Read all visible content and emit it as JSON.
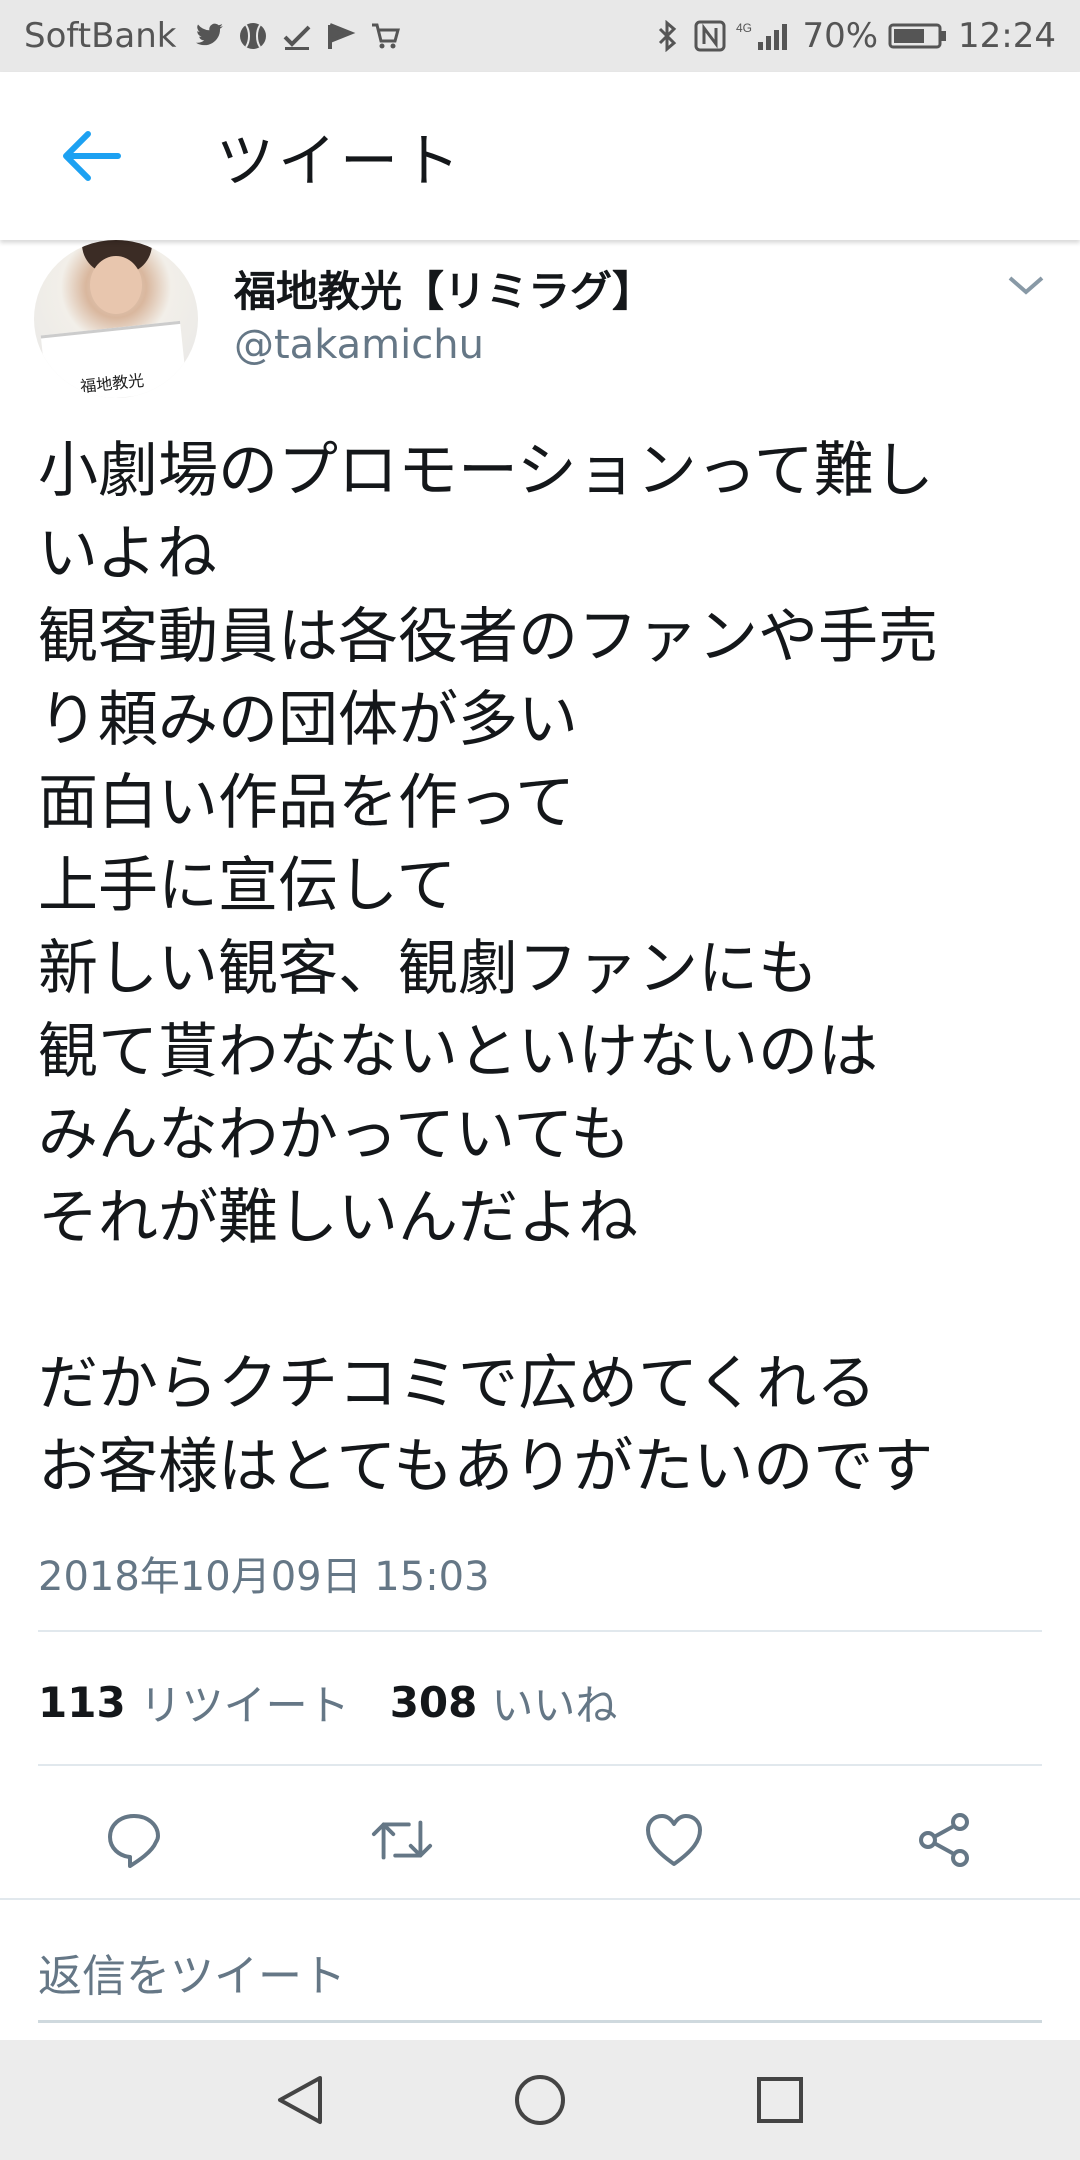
{
  "status_bar": {
    "carrier": "SoftBank",
    "battery": "70%",
    "time": "12:24",
    "network": "4G",
    "icons": [
      "twitter-icon",
      "baseball-icon",
      "check-icon",
      "flag-icon",
      "cart-icon",
      "bluetooth-icon",
      "nfc-icon",
      "signal-icon",
      "battery-icon"
    ]
  },
  "app_bar": {
    "title": "ツイート",
    "back_icon": "back-arrow-icon"
  },
  "tweet": {
    "avatar_caption": "福地教光",
    "username": "福地教光【リミラグ】",
    "handle": "@takamichu",
    "lines": [
      "小劇場のプロモーションって難し",
      "いよね",
      "観客動員は各役者のファンや手売",
      "り頼みの団体が多い",
      "面白い作品を作って",
      "上手に宣伝して",
      "新しい観客、観劇ファンにも",
      "観て貰わなないといけないのは",
      "みんなわかっていても",
      "それが難しいんだよね",
      "",
      "だからクチコミで広めてくれる",
      "お客様はとてもありがたいのです"
    ],
    "timestamp": "2018年10月09日 15:03",
    "retweet_count": "113",
    "retweet_label": "リツイート",
    "like_count": "308",
    "like_label": "いいね"
  },
  "actions": [
    "reply-icon",
    "retweet-icon",
    "like-icon",
    "share-icon"
  ],
  "reply": {
    "placeholder": "返信をツイート"
  },
  "nav": [
    "back-triangle-icon",
    "home-circle-icon",
    "recents-square-icon"
  ],
  "colors": {
    "accent": "#1da1f2",
    "text": "#14171a",
    "secondary": "#657786",
    "divider": "#e1e8ed"
  }
}
